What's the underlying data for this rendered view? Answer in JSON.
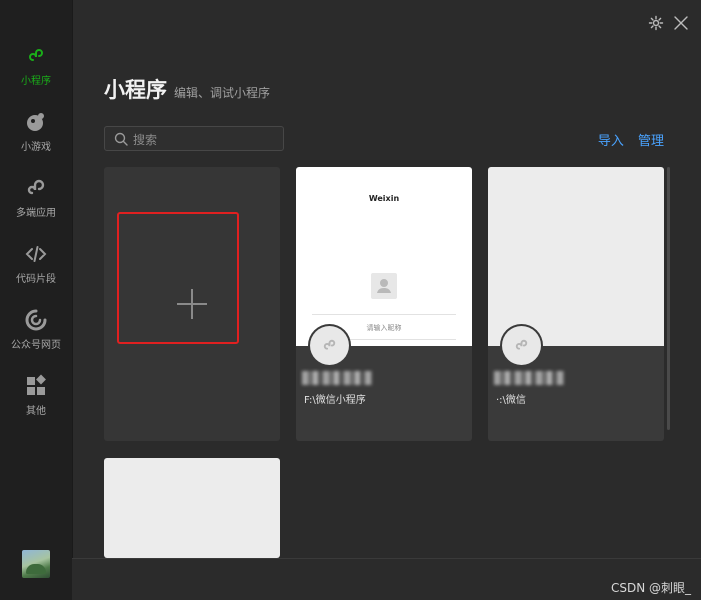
{
  "sidebar": {
    "items": [
      {
        "label": "小程序",
        "icon": "miniprogram-icon",
        "active": true
      },
      {
        "label": "小游戏",
        "icon": "minigame-icon"
      },
      {
        "label": "多端应用",
        "icon": "multiplatform-icon"
      },
      {
        "label": "代码片段",
        "icon": "code-icon"
      },
      {
        "label": "公众号网页",
        "icon": "official-account-icon"
      },
      {
        "label": "其他",
        "icon": "grid-icon"
      }
    ],
    "avatar_icon": "user-avatar"
  },
  "header": {
    "title": "小程序",
    "subtitle": "编辑、调试小程序",
    "settings_icon": "gear-icon",
    "close_icon": "close-icon"
  },
  "search": {
    "placeholder": "搜索",
    "icon": "search-icon"
  },
  "actions": {
    "import_label": "导入",
    "manage_label": "管理"
  },
  "projects": [
    {
      "preview_title": "Weixin",
      "preview_hint": "请输入昵称",
      "path": "F:\\微信小程序"
    },
    {
      "path": "·:\\微信"
    }
  ],
  "create_card": {
    "icon": "plus-icon"
  },
  "colors": {
    "accent": "#1aad19",
    "link": "#4aa3ff",
    "highlight": "#e02020"
  },
  "watermark": "CSDN @刺眼_"
}
